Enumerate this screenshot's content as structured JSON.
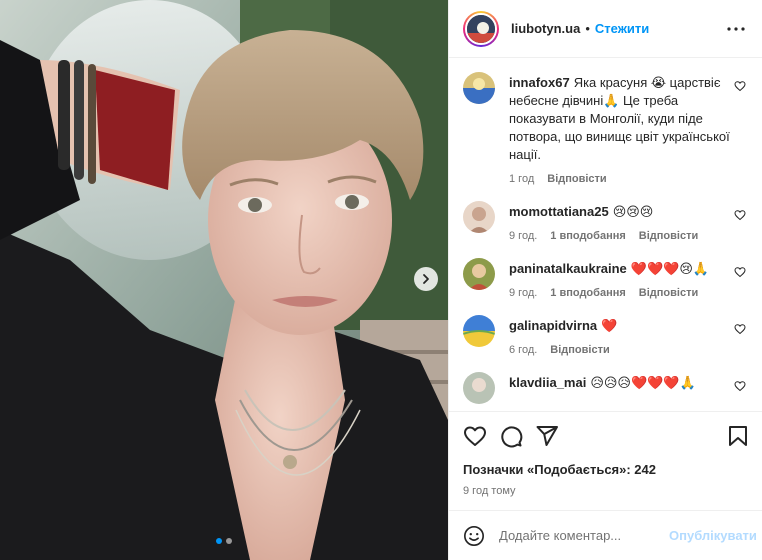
{
  "header": {
    "username": "liubotyn.ua",
    "separator": "•",
    "follow_label": "Стежити",
    "avatar_icon": "account-avatar-icon",
    "more_icon": "more-options-icon"
  },
  "media": {
    "slide_count": 2,
    "active_slide": 1,
    "next_icon": "chevron-right-icon"
  },
  "comments": [
    {
      "username": "innafox67",
      "text": "Яка красуня 😭 царствіє небесне дівчині🙏 Це треба показувати в Монголії, куди піде потвора, що винищє цвіт української нації.",
      "time": "1 год",
      "likes": "",
      "reply": "Відповісти",
      "avatar_color": "#d9c27a"
    },
    {
      "username": "momottatiana25",
      "text": "😢😢😢",
      "time": "9 год.",
      "likes": "1 вподобання",
      "reply": "Відповісти",
      "avatar_color": "#c9a48f"
    },
    {
      "username": "paninatalkaukraine",
      "text": "❤️❤️❤️😢🙏",
      "time": "9 год.",
      "likes": "1 вподобання",
      "reply": "Відповісти",
      "avatar_color": "#8d9b4a"
    },
    {
      "username": "galinapidvirna",
      "text": "❤️",
      "time": "6 год.",
      "likes": "",
      "reply": "Відповісти",
      "avatar_color": "#3f7fd6"
    },
    {
      "username": "klavdiia_mai",
      "text": "😥😥😥❤️❤️❤️🙏",
      "time": "",
      "likes": "",
      "reply": "",
      "avatar_color": "#b9c3b5"
    }
  ],
  "actions": {
    "like_icon": "heart-icon",
    "comment_icon": "comment-icon",
    "share_icon": "share-icon",
    "save_icon": "bookmark-icon",
    "likes_text": "Позначки «Подобається»: 242",
    "posted_time": "9 год тому"
  },
  "composer": {
    "emoji_icon": "emoji-icon",
    "placeholder": "Додайте коментар...",
    "post_label": "Опублікувати"
  },
  "colors": {
    "accent": "#0095f6",
    "post_disabled": "#b3dbff",
    "secondary_text": "#737373",
    "border": "#efefef"
  }
}
